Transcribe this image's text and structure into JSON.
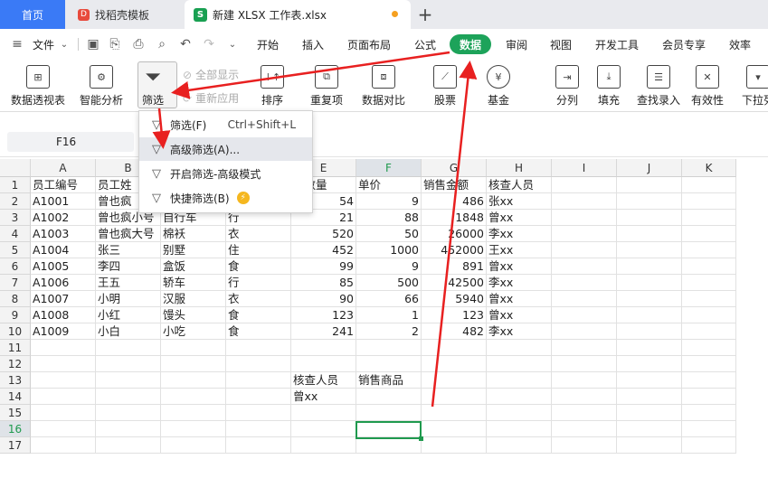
{
  "tabs": {
    "home": "首页",
    "template": "找稻壳模板",
    "file": "新建 XLSX 工作表.xlsx",
    "add": "+"
  },
  "menu": {
    "file": "文件",
    "items": [
      "开始",
      "插入",
      "页面布局",
      "公式",
      "数据",
      "审阅",
      "视图",
      "开发工具",
      "会员专享",
      "效率"
    ]
  },
  "ribbon": {
    "pivot": "数据透视表",
    "smart": "智能分析",
    "filter": "筛选",
    "show_all": "全部显示",
    "reapply": "重新应用",
    "sort": "排序",
    "duplicates": "重复项",
    "compare": "数据对比",
    "stock": "股票",
    "fund": "基金",
    "split": "分列",
    "fill": "填充",
    "lookup": "查找录入",
    "validity": "有效性",
    "dropdown_list": "下拉列"
  },
  "namebox": {
    "value": "F16"
  },
  "dropdown_menu": {
    "filter": "筛选(F)",
    "filter_shortcut": "Ctrl+Shift+L",
    "advanced": "高级筛选(A)...",
    "advanced_mode": "开启筛选-高级模式",
    "quick": "快捷筛选(B)"
  },
  "columns": [
    "A",
    "B",
    "C",
    "D",
    "E",
    "F",
    "G",
    "H",
    "I",
    "J",
    "K"
  ],
  "rows": [
    "1",
    "2",
    "3",
    "4",
    "5",
    "6",
    "7",
    "8",
    "9",
    "10",
    "11",
    "12",
    "13",
    "14",
    "15",
    "16",
    "17"
  ],
  "table": {
    "r1": [
      "员工编号",
      "员工姓",
      "",
      "",
      "售数量",
      "单价",
      "销售金额",
      "核查人员"
    ],
    "r2": [
      "A1001",
      "曾也疯",
      "",
      "",
      "54",
      "9",
      "486",
      "张xx"
    ],
    "r3": [
      "A1002",
      "曾也疯小号",
      "自行车",
      "行",
      "21",
      "88",
      "1848",
      "曾xx"
    ],
    "r4": [
      "A1003",
      "曾也疯大号",
      "棉袄",
      "衣",
      "520",
      "50",
      "26000",
      "李xx"
    ],
    "r5": [
      "A1004",
      "张三",
      "别墅",
      "住",
      "452",
      "1000",
      "452000",
      "王xx"
    ],
    "r6": [
      "A1005",
      "李四",
      "盒饭",
      "食",
      "99",
      "9",
      "891",
      "曾xx"
    ],
    "r7": [
      "A1006",
      "王五",
      "轿车",
      "行",
      "85",
      "500",
      "42500",
      "李xx"
    ],
    "r8": [
      "A1007",
      "小明",
      "汉服",
      "衣",
      "90",
      "66",
      "5940",
      "曾xx"
    ],
    "r9": [
      "A1008",
      "小红",
      "馒头",
      "食",
      "123",
      "1",
      "123",
      "曾xx"
    ],
    "r10": [
      "A1009",
      "小白",
      "小吃",
      "食",
      "241",
      "2",
      "482",
      "李xx"
    ],
    "criteria_h1": "核查人员",
    "criteria_h2": "销售商品",
    "criteria_v1": "曾xx"
  },
  "colors": {
    "accent": "#1da35a",
    "arrow": "#e82020",
    "home_tab": "#3a7af6"
  }
}
